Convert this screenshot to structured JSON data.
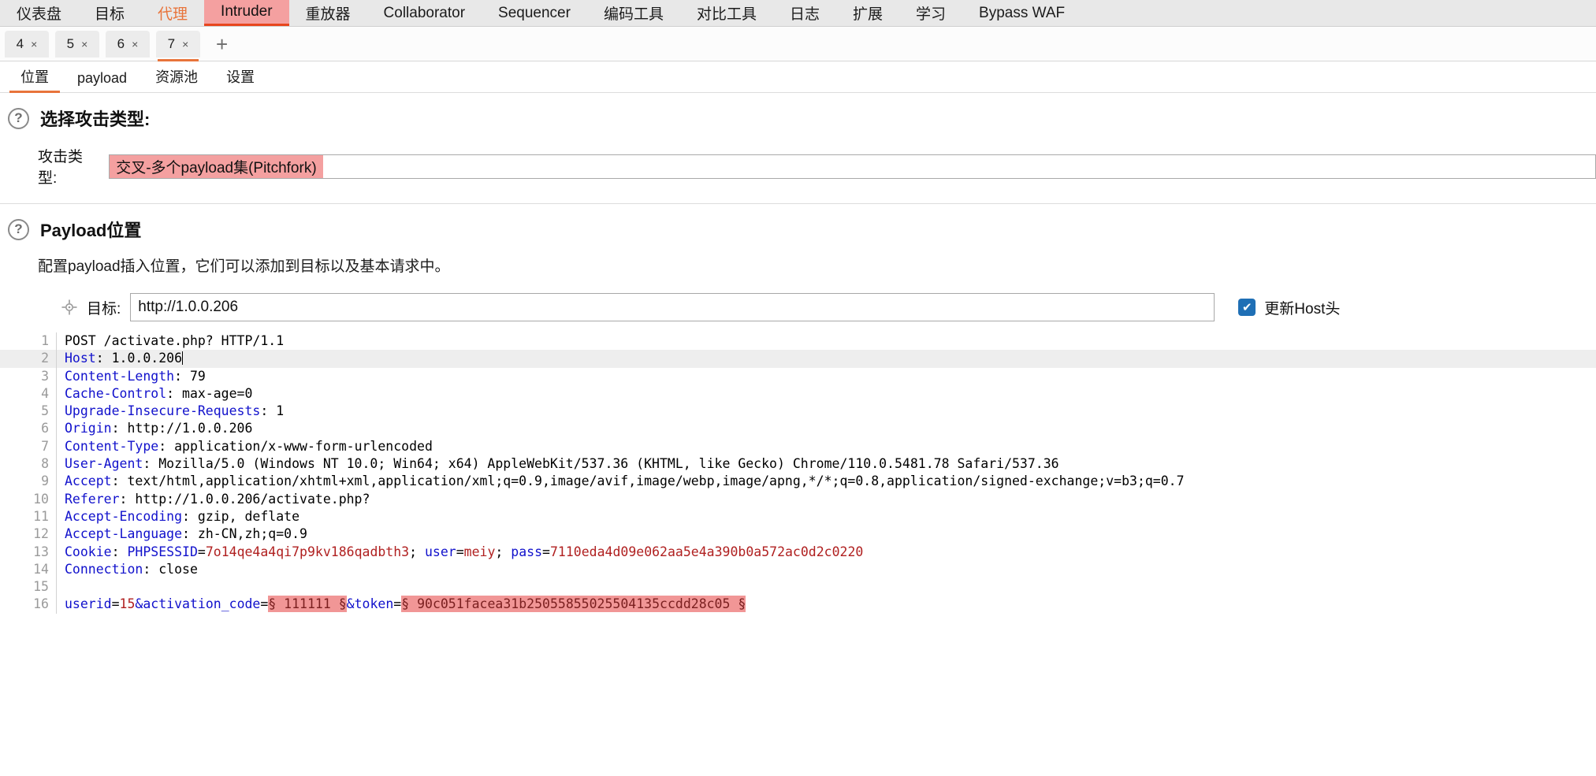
{
  "main_tabs": [
    {
      "label": "仪表盘",
      "state": "normal"
    },
    {
      "label": "目标",
      "state": "normal"
    },
    {
      "label": "代理",
      "state": "accent"
    },
    {
      "label": "Intruder",
      "state": "active"
    },
    {
      "label": "重放器",
      "state": "normal"
    },
    {
      "label": "Collaborator",
      "state": "normal"
    },
    {
      "label": "Sequencer",
      "state": "normal"
    },
    {
      "label": "编码工具",
      "state": "normal"
    },
    {
      "label": "对比工具",
      "state": "normal"
    },
    {
      "label": "日志",
      "state": "normal"
    },
    {
      "label": "扩展",
      "state": "normal"
    },
    {
      "label": "学习",
      "state": "normal"
    },
    {
      "label": "Bypass WAF",
      "state": "normal"
    }
  ],
  "attack_tabs": [
    {
      "label": "4",
      "close": "×",
      "active": false
    },
    {
      "label": "5",
      "close": "×",
      "active": false
    },
    {
      "label": "6",
      "close": "×",
      "active": false
    },
    {
      "label": "7",
      "close": "×",
      "active": true
    }
  ],
  "add_tab_label": "+",
  "sub_tabs": [
    {
      "label": "位置",
      "active": true
    },
    {
      "label": "payload",
      "active": false
    },
    {
      "label": "资源池",
      "active": false
    },
    {
      "label": "设置",
      "active": false
    }
  ],
  "attack_type_section": {
    "help_icon": "?",
    "title": "选择攻击类型:",
    "label": "攻击类型:",
    "value": "交叉-多个payload集(Pitchfork)",
    "highlight_color": "#f4a0a0"
  },
  "payload_position_section": {
    "help_icon": "?",
    "title": "Payload位置",
    "description": "配置payload插入位置，它们可以添加到目标以及基本请求中。",
    "target_icon": "crosshair-icon",
    "target_label": "目标:",
    "target_value": "http://1.0.0.206",
    "update_host_checked": true,
    "update_host_check_glyph": "✔",
    "update_host_label": "更新Host头"
  },
  "request": {
    "lines": [
      {
        "n": "1",
        "highlight": false,
        "tokens": [
          {
            "t": "POST /activate.php? HTTP/1.1",
            "c": "plain"
          }
        ]
      },
      {
        "n": "2",
        "highlight": true,
        "tokens": [
          {
            "t": "Host",
            "c": "key"
          },
          {
            "t": ": 1.0.0.206",
            "c": "plain"
          },
          {
            "t": "",
            "c": "caret"
          }
        ]
      },
      {
        "n": "3",
        "highlight": false,
        "tokens": [
          {
            "t": "Content-Length",
            "c": "key"
          },
          {
            "t": ": 79",
            "c": "plain"
          }
        ]
      },
      {
        "n": "4",
        "highlight": false,
        "tokens": [
          {
            "t": "Cache-Control",
            "c": "key"
          },
          {
            "t": ": max-age=0",
            "c": "plain"
          }
        ]
      },
      {
        "n": "5",
        "highlight": false,
        "tokens": [
          {
            "t": "Upgrade-Insecure-Requests",
            "c": "key"
          },
          {
            "t": ": 1",
            "c": "plain"
          }
        ]
      },
      {
        "n": "6",
        "highlight": false,
        "tokens": [
          {
            "t": "Origin",
            "c": "key"
          },
          {
            "t": ": http://1.0.0.206",
            "c": "plain"
          }
        ]
      },
      {
        "n": "7",
        "highlight": false,
        "tokens": [
          {
            "t": "Content-Type",
            "c": "key"
          },
          {
            "t": ": application/x-www-form-urlencoded",
            "c": "plain"
          }
        ]
      },
      {
        "n": "8",
        "highlight": false,
        "tokens": [
          {
            "t": "User-Agent",
            "c": "key"
          },
          {
            "t": ": Mozilla/5.0 (Windows NT 10.0; Win64; x64) AppleWebKit/537.36 (KHTML, like Gecko) Chrome/110.0.5481.78 Safari/537.36",
            "c": "plain"
          }
        ]
      },
      {
        "n": "9",
        "highlight": false,
        "tokens": [
          {
            "t": "Accept",
            "c": "key"
          },
          {
            "t": ": text/html,application/xhtml+xml,application/xml;q=0.9,image/avif,image/webp,image/apng,*/*;q=0.8,application/signed-exchange;v=b3;q=0.7",
            "c": "plain"
          }
        ]
      },
      {
        "n": "10",
        "highlight": false,
        "tokens": [
          {
            "t": "Referer",
            "c": "key"
          },
          {
            "t": ": http://1.0.0.206/activate.php?",
            "c": "plain"
          }
        ]
      },
      {
        "n": "11",
        "highlight": false,
        "tokens": [
          {
            "t": "Accept-Encoding",
            "c": "key"
          },
          {
            "t": ": gzip, deflate",
            "c": "plain"
          }
        ]
      },
      {
        "n": "12",
        "highlight": false,
        "tokens": [
          {
            "t": "Accept-Language",
            "c": "key"
          },
          {
            "t": ": zh-CN,zh;q=0.9",
            "c": "plain"
          }
        ]
      },
      {
        "n": "13",
        "highlight": false,
        "tokens": [
          {
            "t": "Cookie",
            "c": "key"
          },
          {
            "t": ": ",
            "c": "plain"
          },
          {
            "t": "PHPSESSID",
            "c": "key"
          },
          {
            "t": "=",
            "c": "plain"
          },
          {
            "t": "7o14qe4a4qi7p9kv186qadbth3",
            "c": "red"
          },
          {
            "t": "; ",
            "c": "plain"
          },
          {
            "t": "user",
            "c": "key"
          },
          {
            "t": "=",
            "c": "plain"
          },
          {
            "t": "meiy",
            "c": "red"
          },
          {
            "t": "; ",
            "c": "plain"
          },
          {
            "t": "pass",
            "c": "key"
          },
          {
            "t": "=",
            "c": "plain"
          },
          {
            "t": "7110eda4d09e062aa5e4a390b0a572ac0d2c0220",
            "c": "red"
          }
        ]
      },
      {
        "n": "14",
        "highlight": false,
        "tokens": [
          {
            "t": "Connection",
            "c": "key"
          },
          {
            "t": ": close",
            "c": "plain"
          }
        ]
      },
      {
        "n": "15",
        "highlight": false,
        "tokens": []
      },
      {
        "n": "16",
        "highlight": false,
        "tokens": [
          {
            "t": "userid",
            "c": "key"
          },
          {
            "t": "=",
            "c": "plain"
          },
          {
            "t": "15",
            "c": "red"
          },
          {
            "t": "&",
            "c": "key"
          },
          {
            "t": "activation_code",
            "c": "key"
          },
          {
            "t": "=",
            "c": "plain"
          },
          {
            "t": "§ 111111 §",
            "c": "marker"
          },
          {
            "t": "&",
            "c": "key"
          },
          {
            "t": "token",
            "c": "key"
          },
          {
            "t": "=",
            "c": "plain"
          },
          {
            "t": "§ 90c051facea31b25055855025504135ccdd28c05 §",
            "c": "marker"
          }
        ]
      }
    ]
  },
  "colors": {
    "accent_orange": "#e8743b",
    "active_tab_pink": "#f4a0a0",
    "marker_pink": "#f19696",
    "header_blue": "#1111cc",
    "value_red": "#b02020",
    "checkbox_blue": "#1f6fb5"
  }
}
